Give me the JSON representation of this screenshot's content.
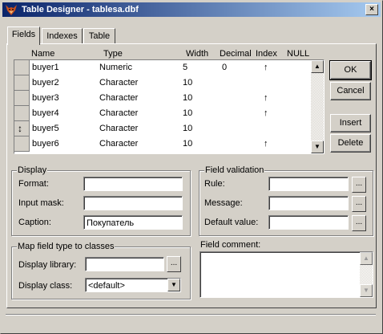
{
  "window": {
    "title": "Table Designer - tablesa.dbf",
    "close_label": "×",
    "app_icon": "fox-icon"
  },
  "tabs": [
    {
      "label": "Fields",
      "active": true
    },
    {
      "label": "Indexes",
      "active": false
    },
    {
      "label": "Table",
      "active": false
    }
  ],
  "grid": {
    "headers": {
      "name": "Name",
      "type": "Type",
      "width": "Width",
      "decimal": "Decimal",
      "index": "Index",
      "null": "NULL"
    },
    "rows": [
      {
        "name": "buyer1",
        "type": "Numeric",
        "width": "5",
        "decimal": "0",
        "index": "↑",
        "current": false
      },
      {
        "name": "buyer2",
        "type": "Character",
        "width": "10",
        "decimal": "",
        "index": "",
        "current": false
      },
      {
        "name": "buyer3",
        "type": "Character",
        "width": "10",
        "decimal": "",
        "index": "↑",
        "current": false
      },
      {
        "name": "buyer4",
        "type": "Character",
        "width": "10",
        "decimal": "",
        "index": "↑",
        "current": false
      },
      {
        "name": "buyer5",
        "type": "Character",
        "width": "10",
        "decimal": "",
        "index": "",
        "current": true
      },
      {
        "name": "buyer6",
        "type": "Character",
        "width": "10",
        "decimal": "",
        "index": "↑",
        "current": false
      }
    ],
    "current_row_marker": "↕"
  },
  "buttons": {
    "ok": "OK",
    "cancel": "Cancel",
    "insert": "Insert",
    "delete": "Delete"
  },
  "display": {
    "group_label": "Display",
    "format_label": "Format:",
    "format_value": "",
    "input_mask_label": "Input mask:",
    "input_mask_value": "",
    "caption_label": "Caption:",
    "caption_value": "Покупатель"
  },
  "validation": {
    "group_label": "Field validation",
    "rule_label": "Rule:",
    "rule_value": "",
    "message_label": "Message:",
    "message_value": "",
    "default_label": "Default value:",
    "default_value": "",
    "ellipsis": "..."
  },
  "map_classes": {
    "group_label": "Map field type to classes",
    "library_label": "Display library:",
    "library_value": "",
    "class_label": "Display class:",
    "class_value": "<default>",
    "ellipsis": "..."
  },
  "comment": {
    "label": "Field comment:",
    "value": ""
  }
}
